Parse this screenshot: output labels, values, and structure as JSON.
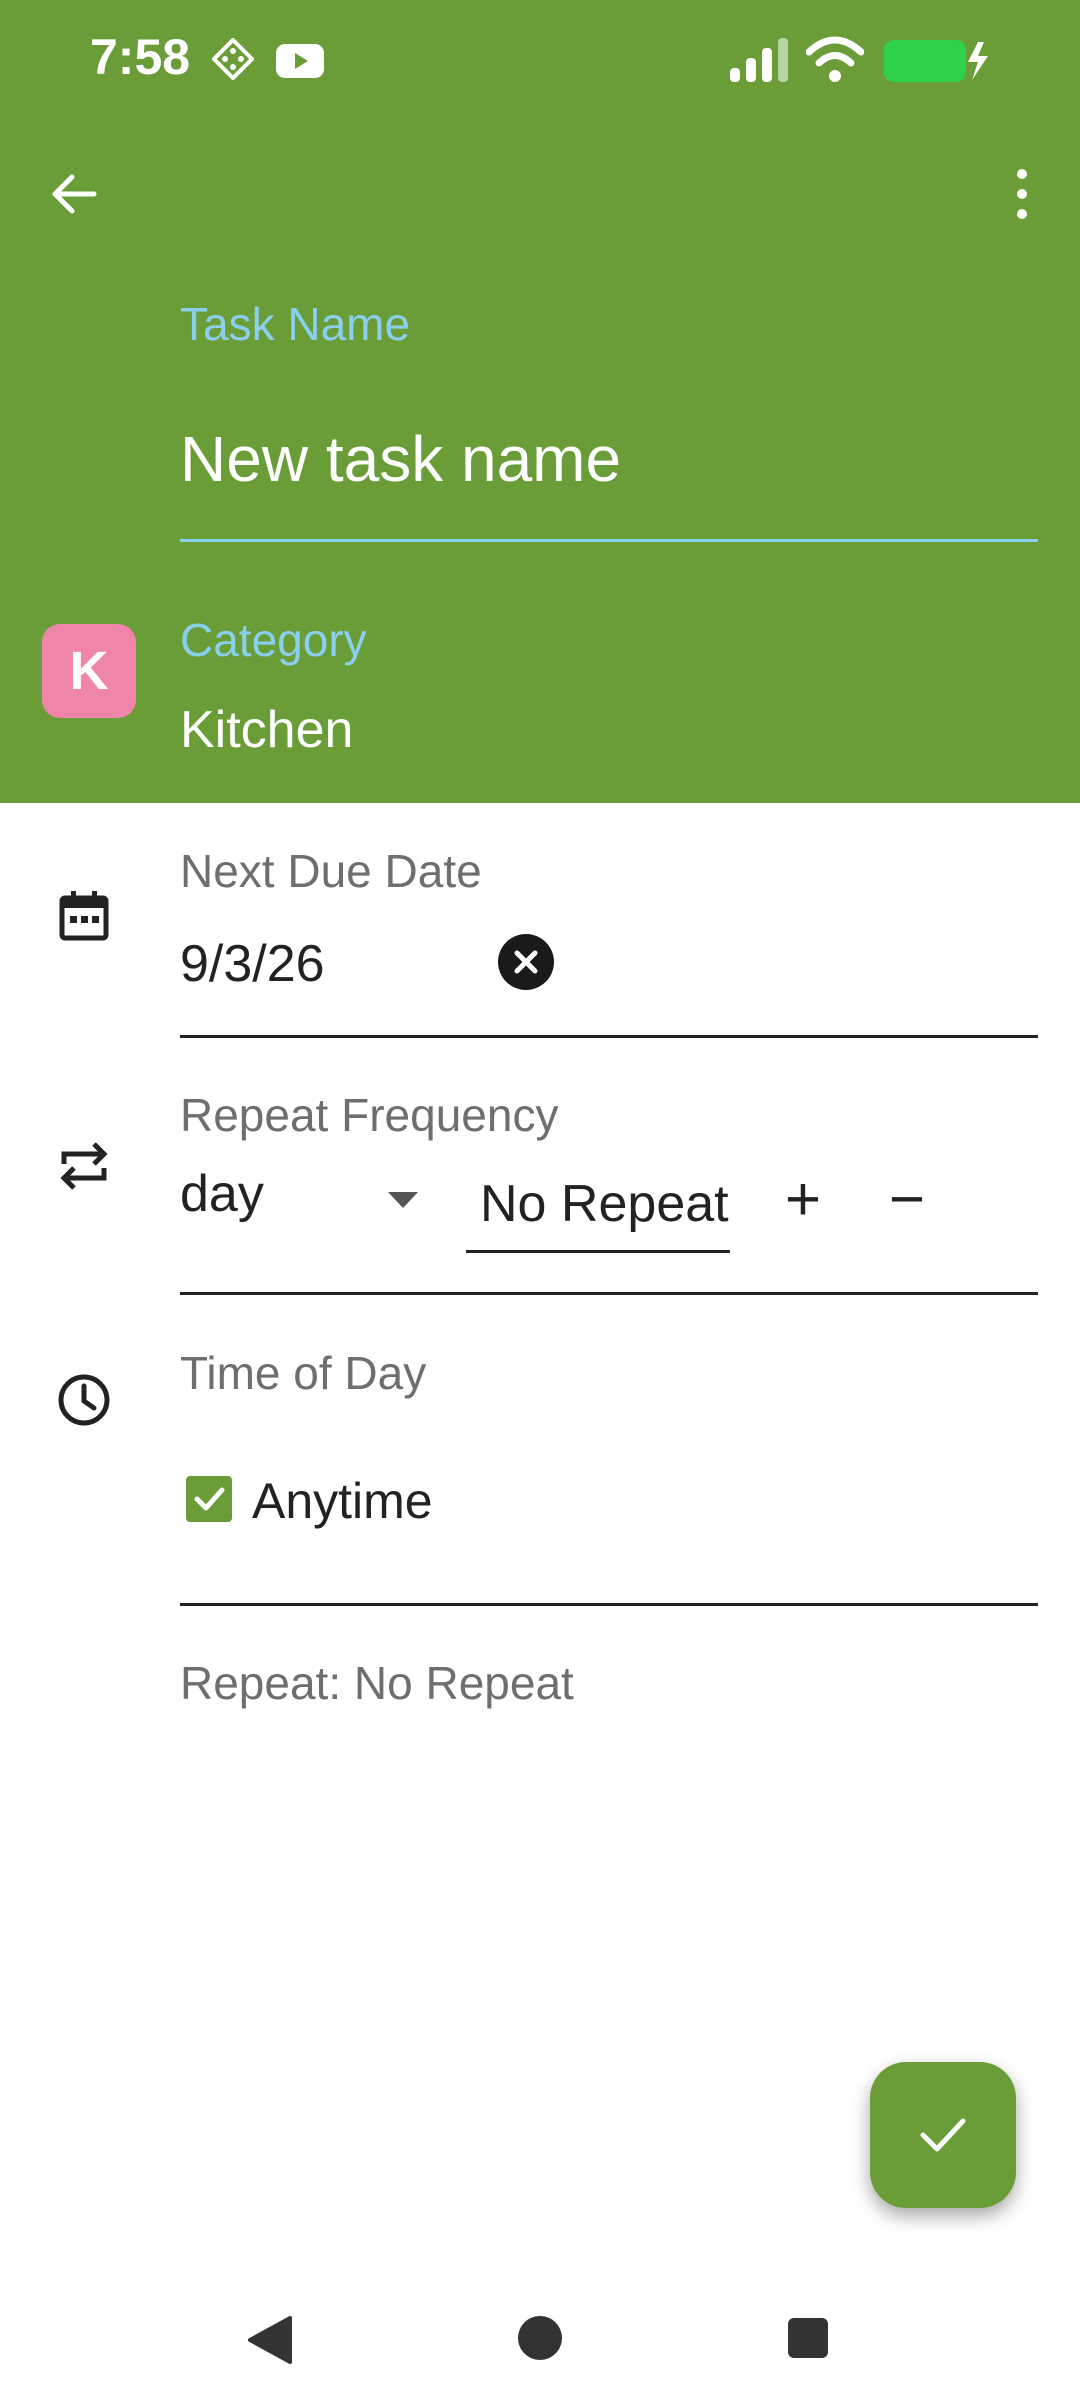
{
  "status_bar": {
    "time": "7:58",
    "icons": [
      "diamond-app-icon",
      "youtube-icon",
      "signal-icon",
      "wifi-icon",
      "battery-charging-icon"
    ]
  },
  "toolbar": {
    "back_icon": "arrow-left-icon",
    "menu_icon": "more-vert-icon"
  },
  "task_name": {
    "label": "Task Name",
    "value": "New task name"
  },
  "category": {
    "label": "Category",
    "badge_letter": "K",
    "value": "Kitchen",
    "badge_color": "#ef86aa"
  },
  "due_date": {
    "label": "Next Due Date",
    "value": "9/3/26",
    "icon": "calendar-icon",
    "clear_icon": "clear-circle-icon"
  },
  "repeat": {
    "label": "Repeat Frequency",
    "unit_selected": "day",
    "count_value": "No Repeat",
    "increment_label": "+",
    "decrement_label": "−",
    "icon": "repeat-icon"
  },
  "time_of_day": {
    "label": "Time of Day",
    "anytime_label": "Anytime",
    "anytime_checked": true,
    "icon": "clock-icon"
  },
  "summary": {
    "text": "Repeat: No Repeat"
  },
  "fab": {
    "icon": "check-icon"
  },
  "nav_bar": {
    "icons": [
      "back-triangle-icon",
      "home-circle-icon",
      "recents-square-icon"
    ]
  },
  "colors": {
    "header": "#6a9c37",
    "accent_label": "#8ad0ee",
    "fab": "#6a9c37"
  }
}
